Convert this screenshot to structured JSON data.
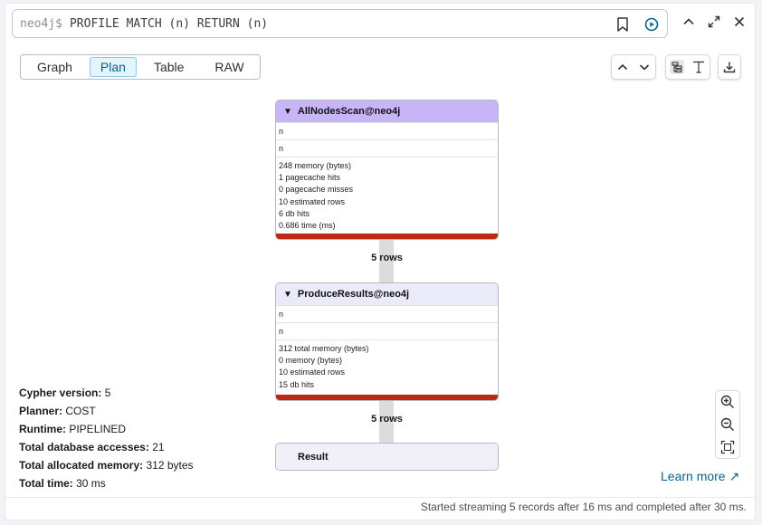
{
  "editor": {
    "prompt": "neo4j$",
    "query": "PROFILE MATCH (n) RETURN (n)"
  },
  "tabs": [
    {
      "label": "Graph",
      "active": false
    },
    {
      "label": "Plan",
      "active": true
    },
    {
      "label": "Table",
      "active": false
    },
    {
      "label": "RAW",
      "active": false
    }
  ],
  "plan": {
    "nodes": [
      {
        "title": "AllNodesScan@neo4j",
        "rows": [
          "n",
          "n"
        ],
        "stats": [
          "248 memory (bytes)",
          "1 pagecache hits",
          "0 pagecache misses",
          "10 estimated rows",
          "6 db hits",
          "0.686 time (ms)"
        ]
      },
      {
        "title": "ProduceResults@neo4j",
        "rows": [
          "n",
          "n"
        ],
        "stats": [
          "312 total memory (bytes)",
          "0 memory (bytes)",
          "10 estimated rows",
          "15 db hits"
        ]
      },
      {
        "title": "Result"
      }
    ],
    "edges": [
      "5 rows",
      "5 rows"
    ]
  },
  "summary": [
    {
      "label": "Cypher version:",
      "value": "5"
    },
    {
      "label": "Planner:",
      "value": "COST"
    },
    {
      "label": "Runtime:",
      "value": "PIPELINED"
    },
    {
      "label": "Total database accesses:",
      "value": "21"
    },
    {
      "label": "Total allocated memory:",
      "value": "312 bytes"
    },
    {
      "label": "Total time:",
      "value": "30 ms"
    }
  ],
  "learn_more": "Learn more ↗",
  "status_text": "Started streaming 5 records after 16 ms and completed after 30 ms.",
  "colors": {
    "accent": "#0a6190",
    "leaf_node_header": "#c8b5f7",
    "cost_bar": "#bb2a14"
  }
}
